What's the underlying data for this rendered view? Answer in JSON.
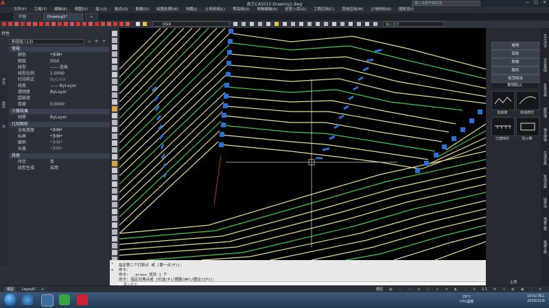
{
  "app": {
    "title": "南方CASS10 Drawing1.dwg",
    "search_placeholder": "键入关键字或短语",
    "window_buttons": [
      "—",
      "□",
      "✕"
    ]
  },
  "menus": [
    "文件(F)",
    "工具(T)",
    "编辑(E)",
    "视图(V)",
    "插入(I)",
    "格式(O)",
    "数据(D)",
    "绘图处理(W)",
    "地籍(J)",
    "土地利用(L)",
    "等高线(S)",
    "地物编辑(A)",
    "检查入库(G)",
    "工程应用(C)",
    "其他应用(M)",
    "土地材料(K)",
    "图斑设计"
  ],
  "tabs": [
    {
      "label": "开始",
      "active": false
    },
    {
      "label": "Drawing1*",
      "active": true
    },
    {
      "label": "+",
      "active": false
    }
  ],
  "toolbar": {
    "layer_name": "DGX",
    "command_search_placeholder": "输入文字"
  },
  "properties": {
    "header": "特性",
    "selection": "多段线 (13)",
    "side_labels": [
      "特性",
      "图层",
      "块"
    ],
    "sections": [
      {
        "title": "常规",
        "rows": [
          {
            "key": "颜色",
            "value": "*多种*"
          },
          {
            "key": "图层",
            "value": "DGX"
          },
          {
            "key": "线型",
            "value": "—— 连续"
          },
          {
            "key": "线型比例",
            "value": "1.0000"
          },
          {
            "key": "打印样式",
            "value": "ByColor"
          },
          {
            "key": "线宽",
            "value": "—— ByLayer"
          },
          {
            "key": "透明度",
            "value": "ByLayer"
          },
          {
            "key": "超链接",
            "value": ""
          },
          {
            "key": "厚度",
            "value": "0.0000"
          }
        ]
      },
      {
        "title": "三维效果",
        "rows": [
          {
            "key": "材质",
            "value": "ByLayer"
          }
        ]
      },
      {
        "title": "几何图形",
        "rows": [
          {
            "key": "全局宽度",
            "value": "*多种*"
          },
          {
            "key": "标高",
            "value": "*多种*"
          },
          {
            "key": "面积",
            "value": "*多种*"
          },
          {
            "key": "长度",
            "value": "*多种*"
          }
        ]
      },
      {
        "title": "其他",
        "rows": [
          {
            "key": "闭合",
            "value": "否"
          },
          {
            "key": "线型生成",
            "value": "启用"
          }
        ]
      }
    ]
  },
  "command_line": {
    "history": [
      "指定第二个打断点 或 [第一点(F)]:",
      "命令:",
      "命令: _.erase 找到 1 个",
      "命令: 指定对角点或 [栏选(F)/圈围(WP)/圈交(CP)]:"
    ],
    "input_placeholder": "键入命令"
  },
  "right_panel": {
    "buttons": [
      "坡地",
      "田坎",
      "斜坡",
      "陡坎",
      "坎顶排水"
    ],
    "section": "堤坝防火",
    "items": [
      "加高坡",
      "单线田坎",
      "已建田坎",
      "防火带"
    ],
    "footer": "土质"
  },
  "right_tabs": [
    "文字注记",
    "定位基础",
    "水系设施",
    "居民地",
    "独立地物",
    "交通设施",
    "管线设施",
    "境界线",
    "地貌土质",
    "植被土质"
  ],
  "status_bar": {
    "tabs": [
      "模型",
      "Layout1",
      "+"
    ],
    "model_label": "模型",
    "scale": "1:1"
  },
  "taskbar": {
    "temperature": "29°C",
    "temp_label": "CPU温度",
    "time": "19:52 周三",
    "date": "2020/12/9"
  }
}
